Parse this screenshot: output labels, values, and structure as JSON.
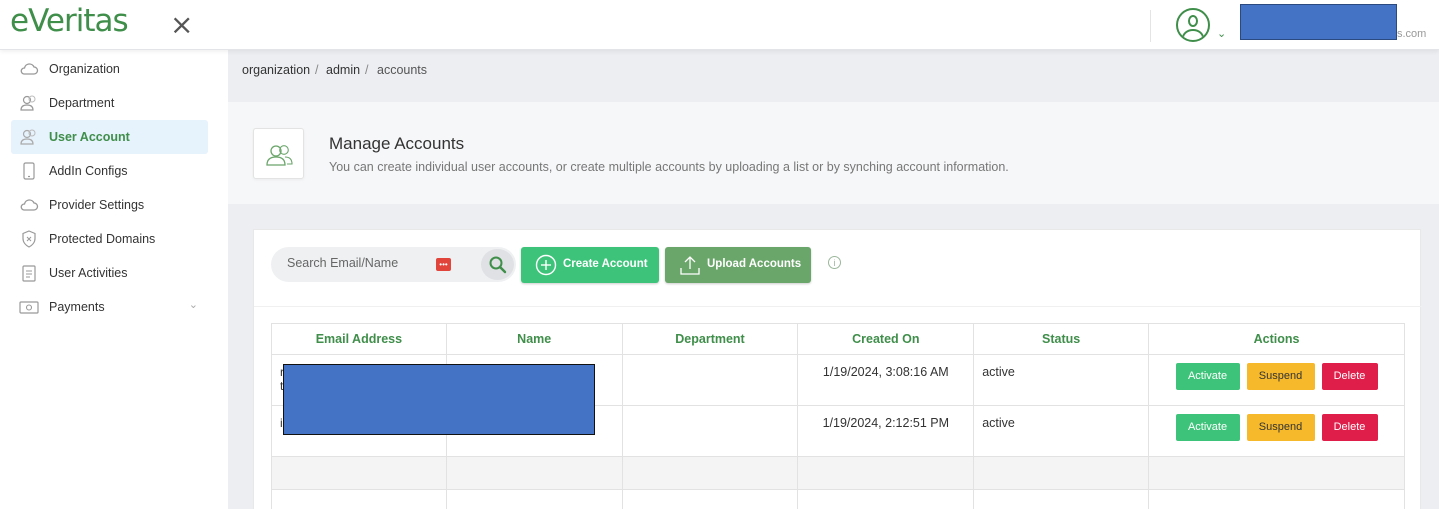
{
  "app": {
    "logo_text_prefix": "e",
    "logo_text_suffix": "eritas",
    "logo_check": "V",
    "brand_color": "#3f8e4a"
  },
  "topbar": {
    "close_glyph": "×",
    "email_tail": "s.com",
    "caret": "⌄"
  },
  "sidebar": {
    "items": [
      {
        "label": "Organization",
        "icon": "cloud-icon",
        "active": false
      },
      {
        "label": "Department",
        "icon": "users-icon",
        "active": false
      },
      {
        "label": "User Account",
        "icon": "users-icon",
        "active": true
      },
      {
        "label": "AddIn Configs",
        "icon": "phone-icon",
        "active": false
      },
      {
        "label": "Provider Settings",
        "icon": "cloud-icon",
        "active": false
      },
      {
        "label": "Protected Domains",
        "icon": "shield-icon",
        "active": false
      },
      {
        "label": "User Activities",
        "icon": "clipboard-icon",
        "active": false
      },
      {
        "label": "Payments",
        "icon": "money-icon",
        "active": false,
        "has_children": true
      }
    ]
  },
  "breadcrumb": {
    "items": [
      "organization",
      "admin",
      "accounts"
    ],
    "separator": "/"
  },
  "header": {
    "title": "Manage Accounts",
    "description": "You can create individual user accounts, or create multiple accounts by uploading a list or by synching account information."
  },
  "toolbar": {
    "search_placeholder": "Search Email/Name",
    "pw_icon_glyph": "•••",
    "create_label": "Create Account",
    "upload_label": "Upload Accounts",
    "info_glyph": "i"
  },
  "table": {
    "columns": [
      "Email Address",
      "Name",
      "Department",
      "Created On",
      "Status",
      "Actions"
    ],
    "rows": [
      {
        "email_line1": "r",
        "email_line2": "t",
        "name": "",
        "department": "",
        "created_on": "1/19/2024, 3:08:16 AM",
        "status": "active"
      },
      {
        "email_line1": "i",
        "email_line2": "",
        "name": "",
        "department": "",
        "created_on": "1/19/2024, 2:12:51 PM",
        "status": "active"
      }
    ],
    "actions": {
      "activate": "Activate",
      "suspend": "Suspend",
      "delete": "Delete"
    }
  },
  "colors": {
    "green": "#3ec47a",
    "upload_green": "#6aa56a",
    "suspend": "#f6b92b",
    "delete": "#df1f4a",
    "redaction": "#4472c4"
  }
}
